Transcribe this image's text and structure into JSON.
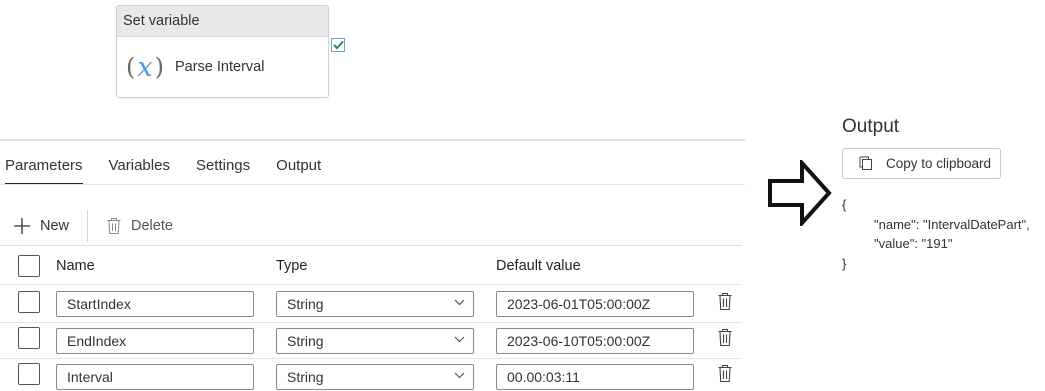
{
  "activity": {
    "header": "Set variable",
    "icon": "variable-x-icon",
    "name": "Parse Interval",
    "status": "succeeded-check-icon"
  },
  "tabs": [
    {
      "label": "Parameters",
      "active": true
    },
    {
      "label": "Variables",
      "active": false
    },
    {
      "label": "Settings",
      "active": false
    },
    {
      "label": "Output",
      "active": false
    }
  ],
  "toolbar": {
    "new_label": "New",
    "delete_label": "Delete"
  },
  "table": {
    "columns": [
      "Name",
      "Type",
      "Default value"
    ],
    "rows": [
      {
        "name": "StartIndex",
        "type": "String",
        "default": "2023-06-01T05:00:00Z"
      },
      {
        "name": "EndIndex",
        "type": "String",
        "default": "2023-06-10T05:00:00Z"
      },
      {
        "name": "Interval",
        "type": "String",
        "default": "00.00:03:11"
      }
    ]
  },
  "output": {
    "title": "Output",
    "copy_label": "Copy to clipboard",
    "json_open": "{",
    "json_line1": "\"name\": \"IntervalDatePart\",",
    "json_line2": "\"value\": \"191\"",
    "json_close": "}"
  },
  "colors": {
    "accent_blue": "#4f9ad8",
    "check_green": "#2e8b57"
  }
}
